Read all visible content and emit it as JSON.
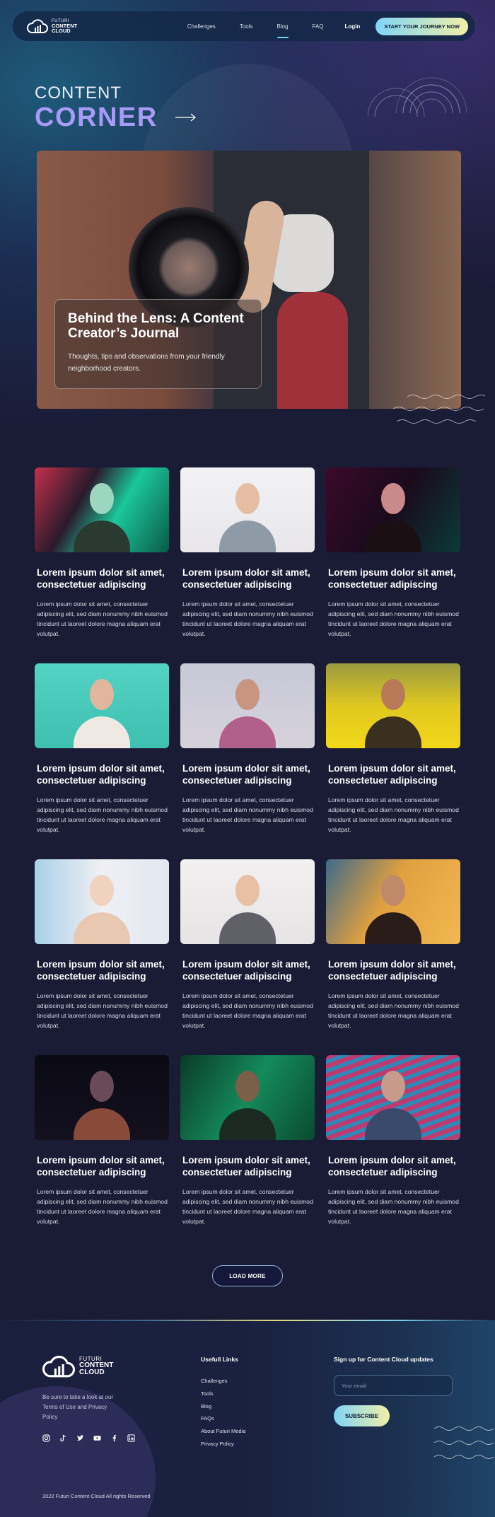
{
  "nav": {
    "logo_small": "FUTURI",
    "logo_line1": "CONTENT",
    "logo_line2": "CLOUD",
    "links": [
      "Challenges",
      "Tools",
      "Blog",
      "FAQ"
    ],
    "active": "Blog",
    "login": "Login",
    "cta": "START YOUR JOURNEY NOW"
  },
  "hero": {
    "label": "CONTENT",
    "title": "CORNER",
    "card_title": "Behind the Lens: A Content Creator’s Journal",
    "card_subtitle": "Thoughts, tips and observations from your friendly neighborhood creators."
  },
  "articles": [
    {
      "title": "Lorem ipsum dolor sit amet, consectetuer adipiscing",
      "body": "Lorem ipsum dolor sit amet, consectetuer adipiscing elit, sed diam nonummy nibh euismod tincidunt ut laoreet dolore magna aliquam erat volutpat.",
      "image": "neon-green-woman"
    },
    {
      "title": "Lorem ipsum dolor sit amet, consectetuer adipiscing",
      "body": "Lorem ipsum dolor sit amet, consectetuer adipiscing elit, sed diam nonummy nibh euismod tincidunt ut laoreet dolore magna aliquam erat volutpat.",
      "image": "confetti-boy"
    },
    {
      "title": "Lorem ipsum dolor sit amet, consectetuer adipiscing",
      "body": "Lorem ipsum dolor sit amet, consectetuer adipiscing elit, sed diam nonummy nibh euismod tincidunt ut laoreet dolore magna aliquam erat volutpat.",
      "image": "neon-sign-woman"
    },
    {
      "title": "Lorem ipsum dolor sit amet, consectetuer adipiscing",
      "body": "Lorem ipsum dolor sit amet, consectetuer adipiscing elit, sed diam nonummy nibh euismod tincidunt ut laoreet dolore magna aliquam erat volutpat.",
      "image": "teal-confetti-woman"
    },
    {
      "title": "Lorem ipsum dolor sit amet, consectetuer adipiscing",
      "body": "Lorem ipsum dolor sit amet, consectetuer adipiscing elit, sed diam nonummy nibh euismod tincidunt ut laoreet dolore magna aliquam erat volutpat.",
      "image": "balloon-friends"
    },
    {
      "title": "Lorem ipsum dolor sit amet, consectetuer adipiscing",
      "body": "Lorem ipsum dolor sit amet, consectetuer adipiscing elit, sed diam nonummy nibh euismod tincidunt ut laoreet dolore magna aliquam erat volutpat.",
      "image": "yellow-smoke-man"
    },
    {
      "title": "Lorem ipsum dolor sit amet, consectetuer adipiscing",
      "body": "Lorem ipsum dolor sit amet, consectetuer adipiscing elit, sed diam nonummy nibh euismod tincidunt ut laoreet dolore magna aliquam erat volutpat.",
      "image": "blonde-woman"
    },
    {
      "title": "Lorem ipsum dolor sit amet, consectetuer adipiscing",
      "body": "Lorem ipsum dolor sit amet, consectetuer adipiscing elit, sed diam nonummy nibh euismod tincidunt ut laoreet dolore magna aliquam erat volutpat.",
      "image": "lollipop-woman"
    },
    {
      "title": "Lorem ipsum dolor sit amet, consectetuer adipiscing",
      "body": "Lorem ipsum dolor sit amet, consectetuer adipiscing elit, sed diam nonummy nibh euismod tincidunt ut laoreet dolore magna aliquam erat volutpat.",
      "image": "golden-smoke-woman"
    },
    {
      "title": "Lorem ipsum dolor sit amet, consectetuer adipiscing",
      "body": "Lorem ipsum dolor sit amet, consectetuer adipiscing elit, sed diam nonummy nibh euismod tincidunt ut laoreet dolore magna aliquam erat volutpat.",
      "image": "dark-man"
    },
    {
      "title": "Lorem ipsum dolor sit amet, consectetuer adipiscing",
      "body": "Lorem ipsum dolor sit amet, consectetuer adipiscing elit, sed diam nonummy nibh euismod tincidunt ut laoreet dolore magna aliquam erat volutpat.",
      "image": "green-glasses-man"
    },
    {
      "title": "Lorem ipsum dolor sit amet, consectetuer adipiscing",
      "body": "Lorem ipsum dolor sit amet, consectetuer adipiscing elit, sed diam nonummy nibh euismod tincidunt ut laoreet dolore magna aliquam erat volutpat.",
      "image": "striped-light-man"
    }
  ],
  "load_more": "LOAD MORE",
  "footer": {
    "logo_small": "FUTURI",
    "logo_line1": "CONTENT",
    "logo_line2": "CLOUD",
    "terms": "Be sure to take a look at our Terms of Use and Privacy Policy",
    "socials": [
      "instagram-icon",
      "tiktok-icon",
      "twitter-icon",
      "youtube-icon",
      "facebook-icon",
      "linkedin-icon"
    ],
    "links_title": "Usefull Links",
    "links": [
      "Challenges",
      "Tools",
      "Blog",
      "FAQs",
      "About Futuri Media",
      "Privacy Policy"
    ],
    "signup_title": "Sign up for Content Cloud updates",
    "email_placeholder": "Your email",
    "subscribe": "SUBSCRIBE",
    "copyright": "2022 Futuri Content Cloud All rights Reserved"
  },
  "colors": {
    "background": "#1a1b35",
    "accent_gradient_start": "#7fd5f7",
    "accent_gradient_end": "#f1f0a8",
    "corner_purple": "#a89bf5"
  }
}
